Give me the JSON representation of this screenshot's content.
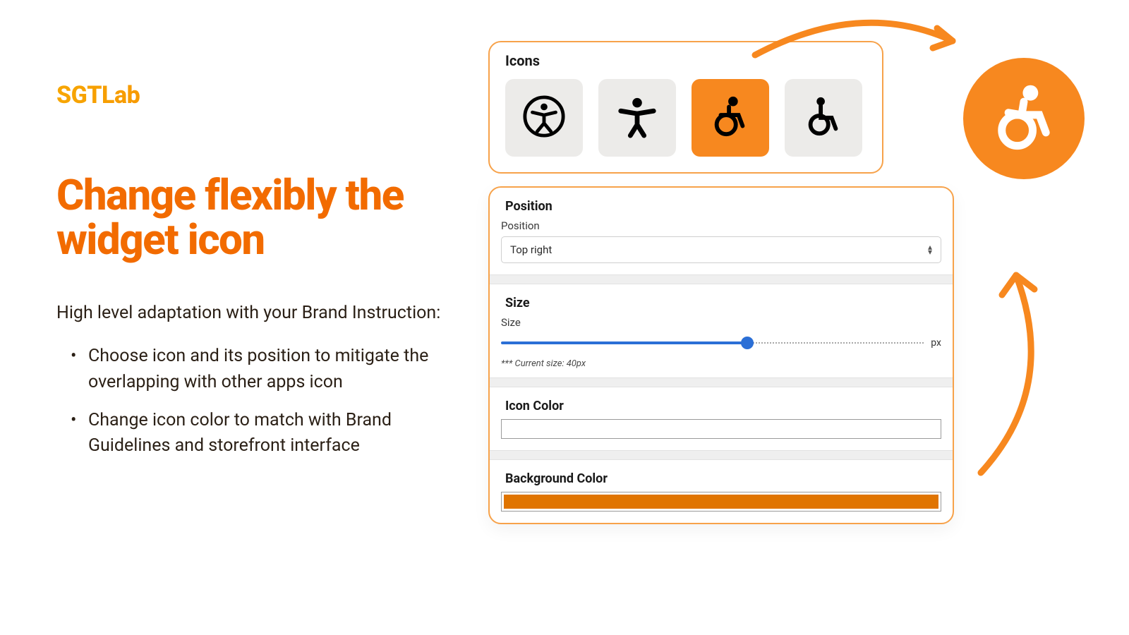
{
  "brand": {
    "logo": "SGTLab"
  },
  "headline": "Change flexibly the widget icon",
  "lead": "High level adaptation with your Brand Instruction:",
  "bullets": [
    "Choose icon and its position to mitigate the overlapping with other apps icon",
    "Change icon color to match with Brand Guidelines and storefront interface"
  ],
  "icons_panel": {
    "title": "Icons",
    "options": [
      "accessibility-circle-icon",
      "accessibility-figure-icon",
      "wheelchair-active-icon",
      "wheelchair-icon"
    ],
    "selected_index": 2
  },
  "position": {
    "section_title": "Position",
    "label": "Position",
    "value": "Top right"
  },
  "size": {
    "section_title": "Size",
    "label": "Size",
    "unit": "px",
    "hint": "*** Current size: 40px",
    "value_percent": 58
  },
  "icon_color": {
    "section_title": "Icon Color",
    "value": "#ffffff"
  },
  "bg_color": {
    "section_title": "Background Color",
    "value": "#e07400"
  }
}
